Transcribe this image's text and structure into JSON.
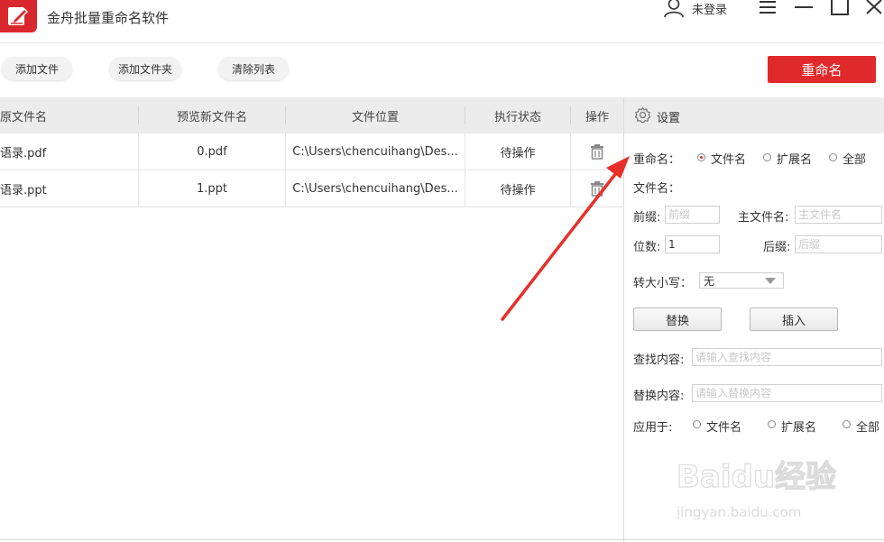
{
  "app": {
    "title": "金舟批量重命名软件",
    "user_label": "未登录"
  },
  "toolbar": {
    "add_file": "添加文件",
    "add_folder": "添加文件夹",
    "clear_list": "清除列表",
    "rename": "重命名"
  },
  "table": {
    "headers": [
      "原文件名",
      "预览新文件名",
      "文件位置",
      "执行状态",
      "操作"
    ],
    "rows": [
      {
        "original": "语录.pdf",
        "preview": "0.pdf",
        "location": "C:\\Users\\chencuihang\\Des...",
        "status": "待操作",
        "action_icon": "trash-icon"
      },
      {
        "original": "语录.ppt",
        "preview": "1.ppt",
        "location": "C:\\Users\\chencuihang\\Des...",
        "status": "待操作",
        "action_icon": "trash-icon"
      }
    ]
  },
  "settings": {
    "title": "设置",
    "rename_label": "重命名：",
    "rename_options": [
      "文件名",
      "扩展名",
      "全部"
    ],
    "rename_selected": "文件名",
    "filename_label": "文件名：",
    "prefix_label": "前缀:",
    "prefix_placeholder": "前缀",
    "main_name_label": "主文件名:",
    "main_name_placeholder": "主文件名",
    "digits_label": "位数:",
    "digits_value": "1",
    "suffix_label": "后缀:",
    "suffix_placeholder": "后缀",
    "case_label": "转大小写：",
    "case_value": "无",
    "replace_button": "替换",
    "insert_button": "插入",
    "find_label": "查找内容:",
    "find_placeholder": "请输入查找内容",
    "replace_label": "替换内容:",
    "replace_placeholder": "请输入替换内容",
    "apply_label": "应用于:",
    "apply_options": [
      "文件名",
      "扩展名",
      "全部"
    ]
  },
  "watermark": {
    "brand": "Baidu经验",
    "url": "jingyan.baidu.com"
  },
  "colors": {
    "accent": "#e0292a",
    "header_bg": "#ececec",
    "annotation_arrow": "#e8302a"
  }
}
